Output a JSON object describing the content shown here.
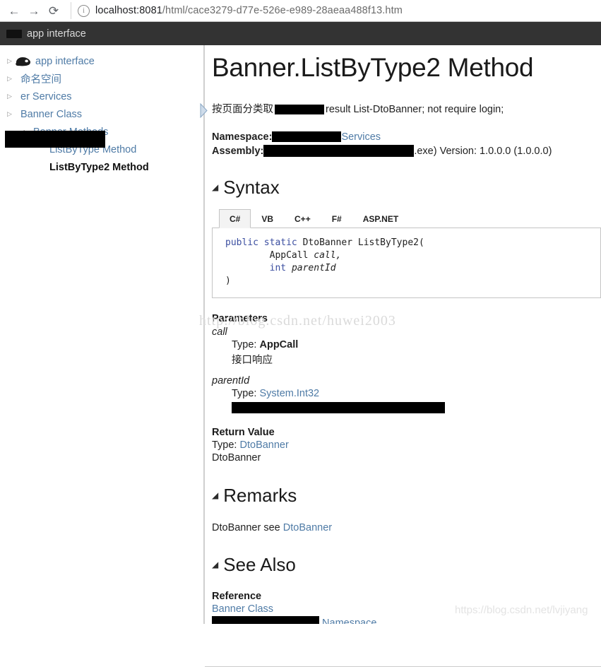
{
  "browser": {
    "back_icon": "back-arrow-icon",
    "forward_icon": "forward-arrow-icon",
    "reload_icon": "reload-icon",
    "info_icon": "ⓘ",
    "url_host": "localhost:8081",
    "url_path": "/html/cace3279-d77e-526e-e989-28aeaa488f13.htm",
    "url_full": "localhost:8081/html/cace3279-d77e-526e-e989-28aeaa488f13.htm"
  },
  "app_header": {
    "title": "app interface",
    "logo_redacted": true
  },
  "sidebar": {
    "items": [
      {
        "label": "app interface",
        "state": "collapsed",
        "indent": 0,
        "kind": "root",
        "icon": "cloud-icon",
        "current": false
      },
      {
        "label": "命名空间",
        "state": "collapsed",
        "indent": 0,
        "kind": "node",
        "current": false
      },
      {
        "label": "er Services",
        "state": "collapsed",
        "indent": 0,
        "kind": "node",
        "current": false,
        "redacted": true
      },
      {
        "label": "Banner Class",
        "state": "collapsed",
        "indent": 0,
        "kind": "node",
        "current": false
      },
      {
        "label": "Banner Methods",
        "state": "expanded",
        "indent": 1,
        "kind": "node",
        "current": false
      },
      {
        "label": "ListByType Method",
        "state": "leaf",
        "indent": 2,
        "kind": "leaf",
        "current": false
      },
      {
        "label": "ListByType2 Method",
        "state": "leaf",
        "indent": 2,
        "kind": "leaf",
        "current": true
      }
    ],
    "expander_collapsed": "▷",
    "expander_expanded": "◢"
  },
  "doc": {
    "title": "Banner.ListByType2 Method",
    "summary_prefix": "按页面分类取",
    "summary_suffix": "result List-DtoBanner; not require login;",
    "namespace_label": "Namespace:",
    "namespace_suffix": "Services",
    "assembly_label": "Assembly:",
    "assembly_suffix": ".exe) Version: 1.0.0.0 (1.0.0.0)",
    "sections": {
      "syntax": "Syntax",
      "remarks": "Remarks",
      "see_also": "See Also"
    },
    "caret": "◢",
    "tabs": [
      {
        "label": "C#",
        "active": true
      },
      {
        "label": "VB",
        "active": false
      },
      {
        "label": "C++",
        "active": false
      },
      {
        "label": "F#",
        "active": false
      },
      {
        "label": "ASP.NET",
        "active": false
      }
    ],
    "code": {
      "line1_kw1": "public",
      "line1_kw2": "static",
      "line1_type": "DtoBanner",
      "line1_method": "ListByType2(",
      "line2_type": "AppCall",
      "line2_param": "call,",
      "line3_type": "int",
      "line3_param": "parentId",
      "line4": ")"
    },
    "parameters_head": "Parameters",
    "parameters": [
      {
        "name": "call",
        "type_label": "Type:",
        "type_value": "AppCall",
        "type_is_link": false,
        "description": "接口响应",
        "redacted_description": false
      },
      {
        "name": "parentId",
        "type_label": "Type:",
        "type_value": "System.Int32",
        "type_is_link": true,
        "description": "",
        "redacted_description": true
      }
    ],
    "return_head": "Return Value",
    "return_type_label": "Type:",
    "return_type_value": "DtoBanner",
    "return_description": "DtoBanner",
    "remarks_text_prefix": "DtoBanner see",
    "remarks_link": "DtoBanner",
    "see_also": {
      "reference_head": "Reference",
      "link1": "Banner Class",
      "link2_suffix": "Namespace"
    }
  },
  "watermarks": {
    "top": "http://blog.csdn.net/huwei2003",
    "bottom": "https://blog.csdn.net/lvjiyang"
  },
  "colors": {
    "link": "#4f7ba6",
    "header_bg": "#333333",
    "keyword": "#3b4ea0",
    "tab_active_bg": "#f3f3f3"
  }
}
